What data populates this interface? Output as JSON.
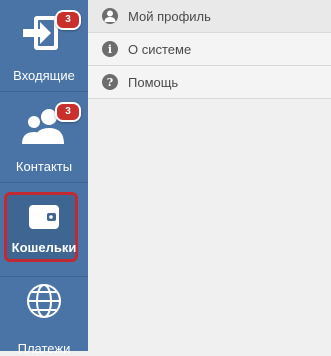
{
  "sidebar": {
    "items": [
      {
        "label": "Входящие",
        "icon": "inbox-arrow-icon",
        "badge": "3"
      },
      {
        "label": "Контакты",
        "icon": "contacts-icon",
        "badge": "3"
      },
      {
        "label": "Кошельки",
        "icon": "wallet-icon",
        "active": true
      },
      {
        "label": "Платежи",
        "icon": "globe-icon"
      }
    ],
    "colors": {
      "background": "#4b74a6",
      "badge": "#c9302c",
      "active_border": "#c22a33"
    }
  },
  "menu": {
    "items": [
      {
        "label": "Мой профиль",
        "icon": "user-icon"
      },
      {
        "label": "О системе",
        "icon": "info-icon",
        "glyph": "i"
      },
      {
        "label": "Помощь",
        "icon": "help-icon",
        "glyph": "?"
      }
    ]
  }
}
